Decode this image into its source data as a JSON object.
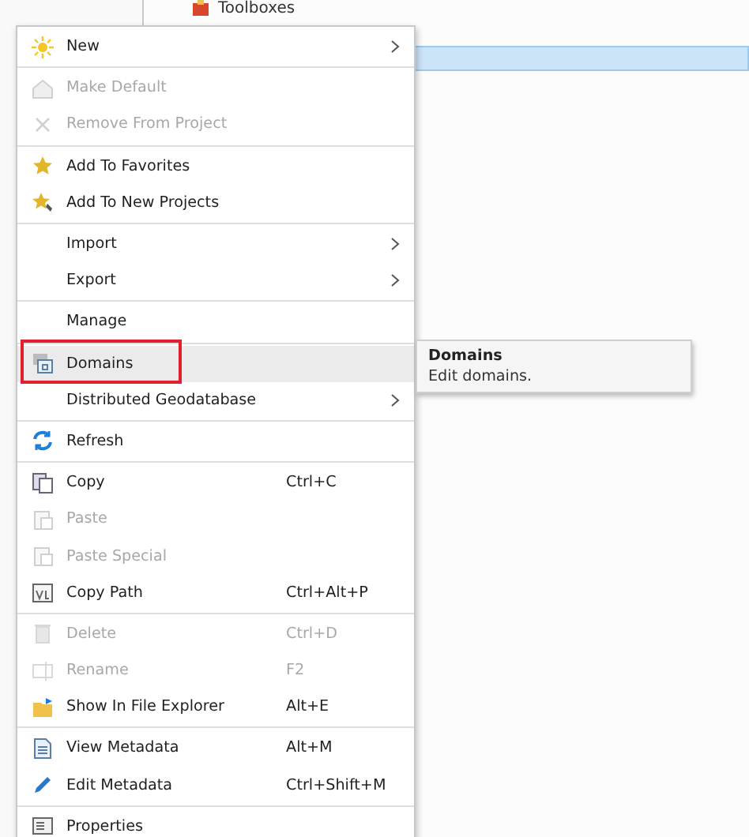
{
  "tree": {
    "items": [
      {
        "label": "Toolboxes",
        "selected": false
      },
      {
        "selected": true
      }
    ]
  },
  "menu": {
    "groups": [
      {
        "items": [
          {
            "label": "New",
            "submenu": true,
            "disabled": false,
            "selected": false,
            "outlined": false
          }
        ]
      },
      {
        "items": [
          {
            "label": "Make Default",
            "submenu": false,
            "disabled": true,
            "selected": false,
            "outlined": false
          },
          {
            "label": "Remove From Project",
            "submenu": false,
            "disabled": true,
            "selected": false,
            "outlined": false
          }
        ]
      },
      {
        "items": [
          {
            "label": "Add To Favorites",
            "submenu": false,
            "disabled": false,
            "selected": false,
            "outlined": false
          },
          {
            "label": "Add To New Projects",
            "submenu": false,
            "disabled": false,
            "selected": false,
            "outlined": false
          }
        ]
      },
      {
        "items": [
          {
            "label": "Import",
            "submenu": true,
            "disabled": false,
            "selected": false,
            "outlined": false
          },
          {
            "label": "Export",
            "submenu": true,
            "disabled": false,
            "selected": false,
            "outlined": false
          }
        ]
      },
      {
        "items": [
          {
            "label": "Manage",
            "submenu": false,
            "disabled": false,
            "selected": false,
            "outlined": false
          }
        ]
      },
      {
        "items": [
          {
            "label": "Domains",
            "submenu": false,
            "disabled": false,
            "selected": true,
            "outlined": true
          },
          {
            "label": "Distributed Geodatabase",
            "submenu": true,
            "disabled": false,
            "selected": false,
            "outlined": false
          }
        ]
      },
      {
        "items": [
          {
            "label": "Refresh",
            "submenu": false,
            "disabled": false,
            "selected": false,
            "outlined": false
          }
        ]
      },
      {
        "items": [
          {
            "label": "Copy",
            "shortcut": "Ctrl+C",
            "submenu": false,
            "disabled": false,
            "selected": false,
            "outlined": false
          },
          {
            "label": "Paste",
            "submenu": false,
            "disabled": true,
            "selected": false,
            "outlined": false
          },
          {
            "label": "Paste Special",
            "submenu": false,
            "disabled": true,
            "selected": false,
            "outlined": false
          },
          {
            "label": "Copy Path",
            "shortcut": "Ctrl+Alt+P",
            "submenu": false,
            "disabled": false,
            "selected": false,
            "outlined": false
          }
        ]
      },
      {
        "items": [
          {
            "label": "Delete",
            "shortcut": "Ctrl+D",
            "submenu": false,
            "disabled": true,
            "selected": false,
            "outlined": false
          },
          {
            "label": "Rename",
            "shortcut": "F2",
            "submenu": false,
            "disabled": true,
            "selected": false,
            "outlined": false
          },
          {
            "label": "Show In File Explorer",
            "shortcut": "Alt+E",
            "submenu": false,
            "disabled": false,
            "selected": false,
            "outlined": false
          }
        ]
      },
      {
        "items": [
          {
            "label": "View Metadata",
            "shortcut": "Alt+M",
            "submenu": false,
            "disabled": false,
            "selected": false,
            "outlined": false
          },
          {
            "label": "Edit Metadata",
            "shortcut": "Ctrl+Shift+M",
            "submenu": false,
            "disabled": false,
            "selected": false,
            "outlined": false
          }
        ]
      },
      {
        "items": [
          {
            "label": "Properties",
            "submenu": false,
            "disabled": false,
            "selected": false,
            "outlined": false
          }
        ]
      }
    ]
  },
  "tooltip": {
    "title": "Domains",
    "text": "Edit domains."
  }
}
